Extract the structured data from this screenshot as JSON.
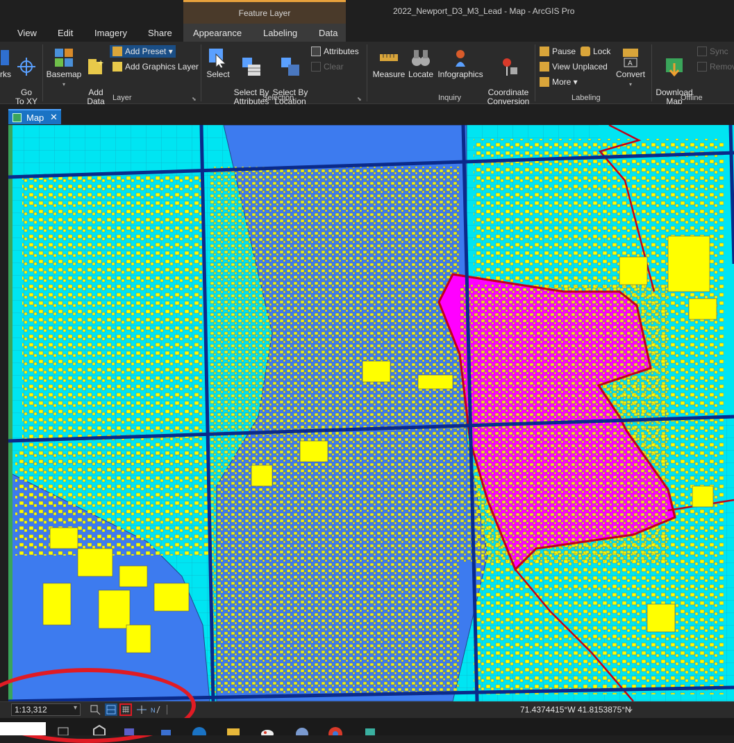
{
  "window": {
    "context_tab": "Feature Layer",
    "title": "2022_Newport_D3_M3_Lead - Map - ArcGIS Pro"
  },
  "tabs": [
    "View",
    "Edit",
    "Imagery",
    "Share",
    "Appearance",
    "Labeling",
    "Data"
  ],
  "ribbon": {
    "layer_group": {
      "label": "Layer",
      "bookmarks_partial": "rks",
      "goto_xy": "Go\nTo XY",
      "basemap": "Basemap",
      "add_data": "Add\nData",
      "add_preset": "Add Preset",
      "add_graphics_layer": "Add Graphics Layer"
    },
    "selection_group": {
      "label": "Selection",
      "select": "Select",
      "select_by_attributes": "Select By\nAttributes",
      "select_by_location": "Select By\nLocation",
      "attributes": "Attributes",
      "clear": "Clear"
    },
    "inquiry_group": {
      "label": "Inquiry",
      "measure": "Measure",
      "locate": "Locate",
      "infographics": "Infographics",
      "coordinate_conversion": "Coordinate\nConversion"
    },
    "labeling_group": {
      "label": "Labeling",
      "pause": "Pause",
      "lock": "Lock",
      "view_unplaced": "View Unplaced",
      "more": "More",
      "convert": "Convert"
    },
    "offline_group": {
      "label": "Offline",
      "download_map": "Download\nMap",
      "sync": "Sync",
      "remove": "Remov"
    }
  },
  "map_view": {
    "tab_label": "Map",
    "colors": {
      "water_area": "#3d7bef",
      "land_area": "#00e5f2",
      "buildings": "#ffff00",
      "selected_area": "#ff00ff",
      "boundary": "#c0001a",
      "grid": "#0a2a8a"
    }
  },
  "status_bar": {
    "scale": "1:13,312",
    "coordinates": "71.4374415°W 41.8153875°N"
  },
  "annotation": {
    "color": "#e01b24",
    "shape": "ellipse"
  }
}
